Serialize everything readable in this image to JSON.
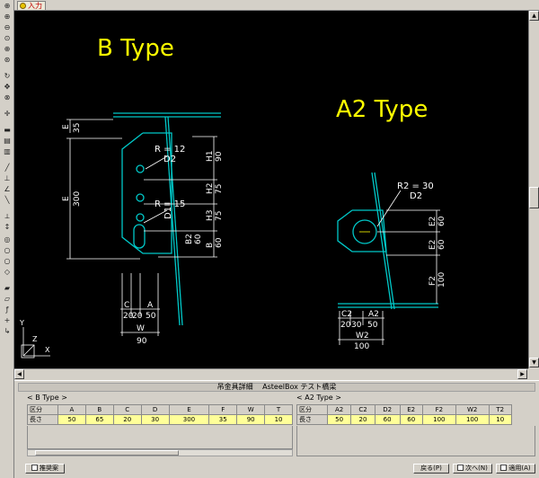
{
  "tab": {
    "label": "入力"
  },
  "drawing": {
    "b_title": "B Type",
    "a2_title": "A2 Type",
    "b_labels": {
      "e": "E",
      "e_top": "35",
      "e_big": "E",
      "e_big_val": "300",
      "r1": "R = 12",
      "d2": "D2",
      "r2": "R = 15",
      "d1": "D1",
      "h1": "H1",
      "h1v": "90",
      "h2": "H2",
      "h2v": "75",
      "h3": "H3",
      "h3v": "75",
      "b2": "B2",
      "b2v": "60",
      "b3": "B",
      "b3v": "60",
      "c": "C",
      "a": "A",
      "c_vals": "20",
      "c_vals2": "20",
      "a_val": "50",
      "w": "W",
      "w_val": "90"
    },
    "a2_labels": {
      "r": "R2 = 30",
      "d2": "D2",
      "e2": "E2",
      "e2v": "60",
      "e2b": "E2",
      "e2bv": "60",
      "f2": "F2",
      "f2v": "100",
      "c2": "C2",
      "a2": "A2",
      "c2v": "20",
      "c2v2": "30",
      "a2v": "50",
      "w2": "W2",
      "w2v": "100"
    }
  },
  "panel": {
    "title": "吊金具詳細 　AsteelBox テスト橋梁",
    "b_header": "< B Type >",
    "a2_header": "< A2 Type >",
    "b_table": {
      "headers": [
        "区分",
        "A",
        "B",
        "C",
        "D",
        "E",
        "F",
        "W",
        "T"
      ],
      "row_label": "長さ",
      "values": [
        "50",
        "65",
        "20",
        "30",
        "300",
        "35",
        "90",
        "10"
      ]
    },
    "a2_table": {
      "headers": [
        "区分",
        "A2",
        "C2",
        "D2",
        "E2",
        "F2",
        "W2",
        "T2"
      ],
      "row_label": "長さ",
      "values": [
        "50",
        "20",
        "60",
        "60",
        "100",
        "100",
        "10"
      ]
    },
    "buttons": {
      "suggest": "推奨案",
      "back": "戻る(P)",
      "next": "次へ(N)",
      "apply": "適用(A)"
    }
  },
  "colors": {
    "title_yellow": "#ffff00",
    "line_cyan": "#00c8c8",
    "dim_white": "#ffffff",
    "cell_yellow": "#ffff99"
  }
}
